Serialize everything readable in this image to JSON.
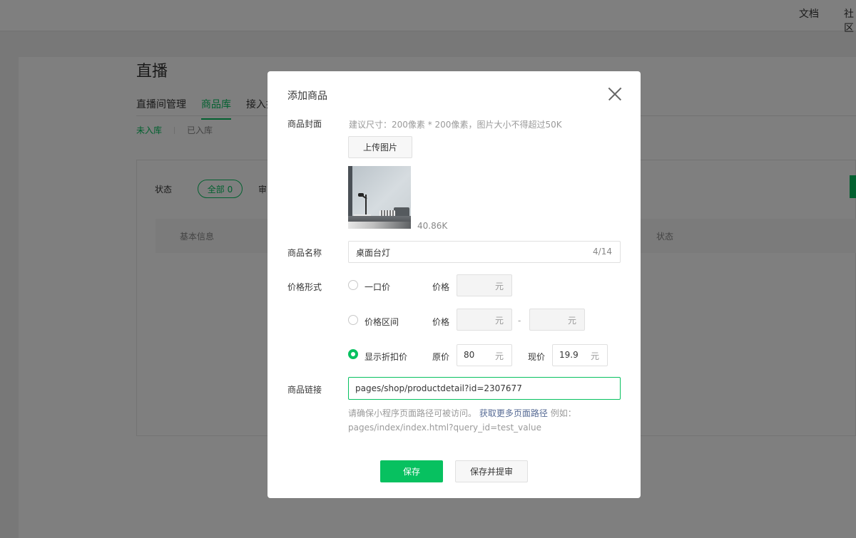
{
  "topbar": {
    "docs": "文档",
    "community": "社区"
  },
  "background": {
    "title": "直播",
    "tabs": [
      "直播间管理",
      "商品库",
      "接入指引"
    ],
    "active_tab": "商品库",
    "subtabs": [
      "未入库",
      "已入库"
    ],
    "status_label": "状态",
    "filter_all": "全部 0",
    "filter_next": "审",
    "table_headers": [
      "基本信息",
      "状态"
    ]
  },
  "dialog": {
    "title": "添加商品",
    "cover": {
      "label": "商品封面",
      "hint": "建议尺寸：200像素 * 200像素，图片大小不得超过50K",
      "upload_label": "上传图片",
      "file_size": "40.86K"
    },
    "name": {
      "label": "商品名称",
      "value": "桌面台灯",
      "counter": "4/14"
    },
    "price": {
      "label": "价格形式",
      "options": [
        {
          "label": "一口价",
          "field_label": "价格",
          "selected": false
        },
        {
          "label": "价格区间",
          "field_label": "价格",
          "selected": false
        },
        {
          "label": "显示折扣价",
          "field_label": "原价",
          "field_label2": "现价",
          "selected": true
        }
      ],
      "unit": "元",
      "range_separator": "-",
      "original_price": "80",
      "current_price": "19.9"
    },
    "link": {
      "label": "商品链接",
      "value": "pages/shop/productdetail?id=2307677",
      "hint_prefix": "请确保小程序页面路径可被访问。",
      "hint_link": "获取更多页面路径",
      "hint_suffix": "例如：pages/index/index.html?query_id=test_value"
    },
    "buttons": {
      "save": "保存",
      "save_submit": "保存并提审"
    }
  }
}
